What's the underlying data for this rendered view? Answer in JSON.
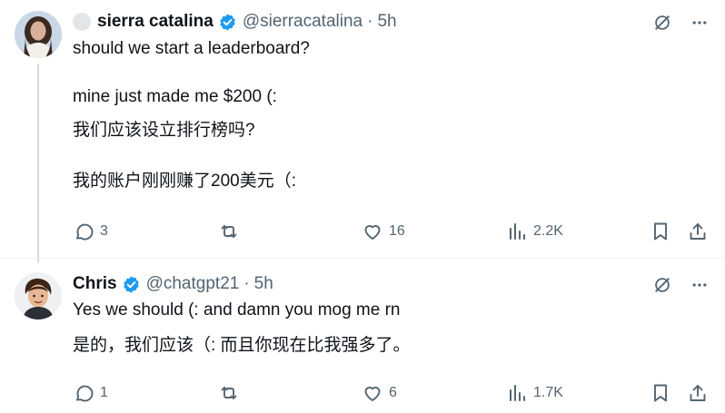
{
  "tweets": [
    {
      "author": {
        "name": "sierra catalina",
        "handle": "@sierracatalina",
        "sep": "·",
        "time": "5h"
      },
      "lines": [
        "should we start a leaderboard?",
        "mine just made me $200 (:",
        "我们应该设立排行榜吗?",
        "我的账户刚刚赚了200美元（:"
      ],
      "stats": {
        "replies": "3",
        "retweets": "",
        "likes": "16",
        "views": "2.2K"
      }
    },
    {
      "author": {
        "name": "Chris",
        "handle": "@chatgpt21",
        "sep": "·",
        "time": "5h"
      },
      "lines": [
        "Yes we should (: and damn you mog me rn",
        "是的，我们应该（: 而且你现在比我强多了。"
      ],
      "stats": {
        "replies": "1",
        "retweets": "",
        "likes": "6",
        "views": "1.7K"
      }
    }
  ],
  "colors": {
    "text": "#0f1419",
    "muted": "#536471",
    "verified": "#1d9bf0",
    "divider": "#eff3f4",
    "thread": "#cfd9de"
  }
}
